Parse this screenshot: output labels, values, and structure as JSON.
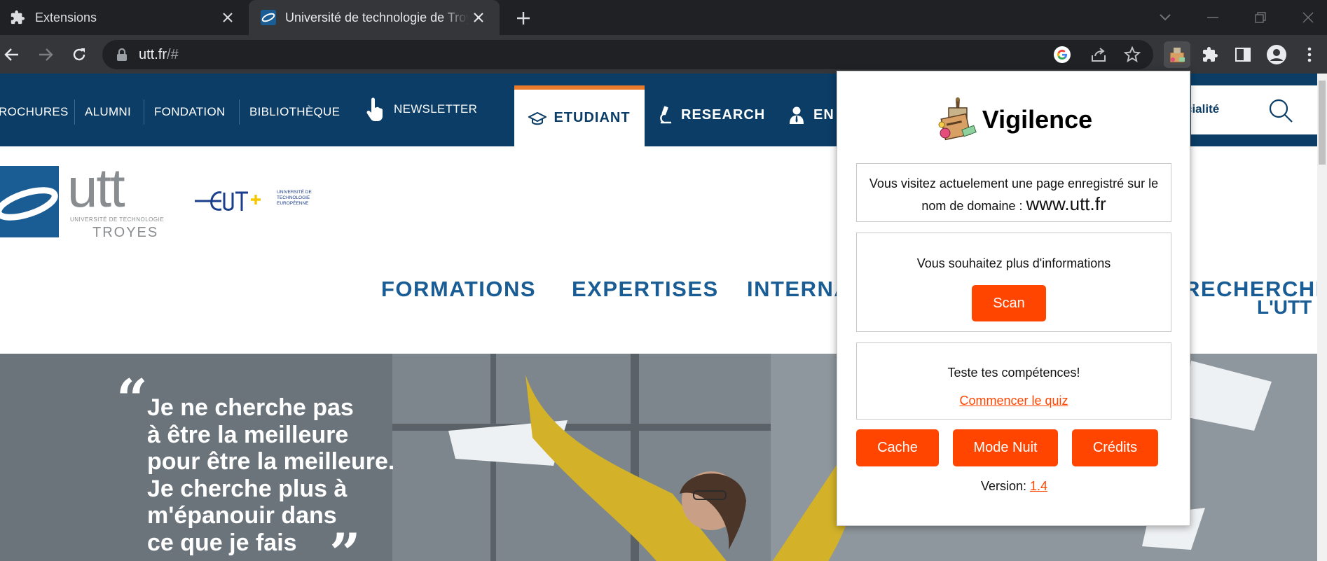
{
  "browser": {
    "tabs": [
      {
        "title": "Extensions"
      },
      {
        "title": "Université de technologie de Troyes"
      }
    ],
    "url_host": "utt.fr",
    "url_rest": "/#"
  },
  "site": {
    "top_links": [
      "ROCHURES",
      "ALUMNI",
      "FONDATION",
      "BIBLIOTHÈQUE"
    ],
    "newsletter": "NEWSLETTER",
    "tab_etudiant": "ETUDIANT",
    "tab_research": "RESEARCH",
    "tab_en": "EN",
    "search_text": "cialité",
    "logo": {
      "utt": "utt",
      "sub": "UNIVERSITÉ DE TECHNOLOGIE",
      "city": "TROYES",
      "eut_small": "UNIVERSITÉ DE TECHNOLOGIE EUROPÉENNE"
    },
    "main_nav": [
      "FORMATIONS",
      "EXPERTISES",
      "INTERNA",
      "RECHERCHE"
    ],
    "lutt": "L'UTT",
    "hero_quote": [
      "Je ne cherche pas",
      "à être la meilleure",
      "pour être la meilleure.",
      "Je cherche plus à",
      "m'épanouir dans",
      "ce que je fais"
    ]
  },
  "popup": {
    "title": "Vigilence",
    "visit_text": "Vous visitez actuelement une page enregistré sur le nom de domaine :",
    "domain": "www.utt.fr",
    "more_info": "Vous souhaitez plus d'informations",
    "scan": "Scan",
    "quiz_title": "Teste tes compétences!",
    "quiz_link": "Commencer le quiz",
    "cache": "Cache",
    "night_mode": "Mode Nuit",
    "credits": "Crédits",
    "version_label": "Version:",
    "version": "1.4"
  },
  "colors": {
    "accent": "#ff4500",
    "site_navy": "#0b3d66",
    "site_blue": "#1a5c94",
    "tab_orange": "#e87a2c"
  }
}
